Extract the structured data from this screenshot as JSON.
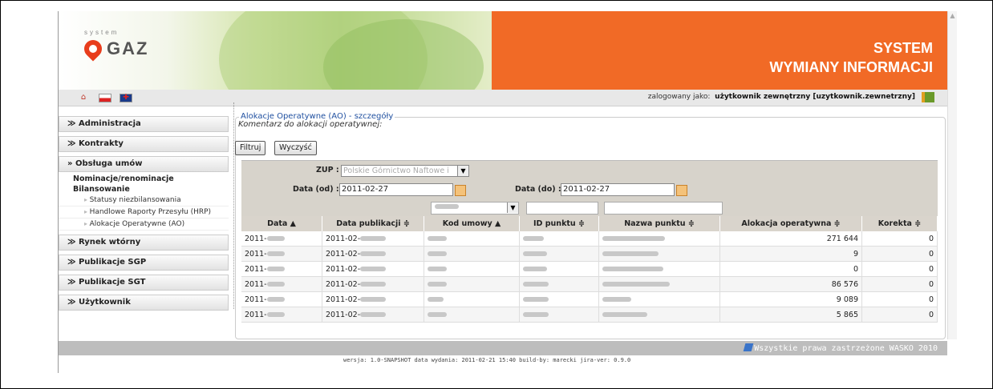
{
  "header": {
    "logo_text": "GAZ",
    "logo_sub": "system",
    "title_line1": "SYSTEM",
    "title_line2": "WYMIANY INFORMACJI"
  },
  "toolbar": {
    "icons": [
      "home-icon",
      "poland-flag-icon",
      "uk-flag-icon"
    ],
    "logged_label": "zalogowany jako:",
    "logged_user": "użytkownik zewnętrzny [uzytkownik.zewnetrzny]"
  },
  "sidebar": {
    "sections": [
      {
        "label": "Administracja"
      },
      {
        "label": "Kontrakty"
      },
      {
        "label": "Obsługa umów"
      },
      {
        "label": "Rynek wtórny"
      },
      {
        "label": "Publikacje SGP"
      },
      {
        "label": "Publikacje SGT"
      },
      {
        "label": "Użytkownik"
      }
    ],
    "obsluga_items": [
      {
        "label": "Nominacje/renominacje"
      },
      {
        "label": "Bilansowanie"
      }
    ],
    "bilansowanie_items": [
      {
        "label": "Statusy niezbilansowania"
      },
      {
        "label": "Handlowe Raporty Przesyłu (HRP)"
      },
      {
        "label": "Alokacje Operatywne (AO)"
      }
    ]
  },
  "content": {
    "fieldset_title": "Alokacje Operatywne (AO) - szczegóły",
    "comment": "Komentarz do alokacji operatywnej:",
    "filter_button": "Filtruj",
    "clear_button": "Wyczyść",
    "zup_label": "ZUP :",
    "zup_value": "Polskie Górnictwo Naftowe i",
    "date_from_label": "Data (od) :",
    "date_from_value": "2011-02-27",
    "date_to_label": "Data (do) :",
    "date_to_value": "2011-02-27"
  },
  "table": {
    "columns": [
      "Data ▲",
      "Data publikacji ≑",
      "Kod umowy ▲",
      "ID punktu ≑",
      "Nazwa punktu ≑",
      "Alokacja operatywna ≑",
      "Korekta ≑"
    ],
    "rows": [
      {
        "data": "2011-",
        "pub": "2011-02-",
        "alok": "271 644",
        "korekta": "0"
      },
      {
        "data": "2011-",
        "pub": "2011-02-",
        "alok": "9",
        "korekta": "0"
      },
      {
        "data": "2011-",
        "pub": "2011-02-",
        "alok": "0",
        "korekta": "0"
      },
      {
        "data": "2011-",
        "pub": "2011-02-",
        "alok": "86 576",
        "korekta": "0"
      },
      {
        "data": "2011-",
        "pub": "2011-02-",
        "alok": "9 089",
        "korekta": "0"
      },
      {
        "data": "2011-",
        "pub": "2011-02-",
        "alok": "5 865",
        "korekta": "0"
      }
    ]
  },
  "footer": {
    "copyright": "Wszystkie prawa zastrzeżone WASKO 2010",
    "version": "wersja: 1.0-SNAPSHOT data wydania: 2011-02-21 15:40 build-by: marecki jira-ver: 0.9.0"
  }
}
